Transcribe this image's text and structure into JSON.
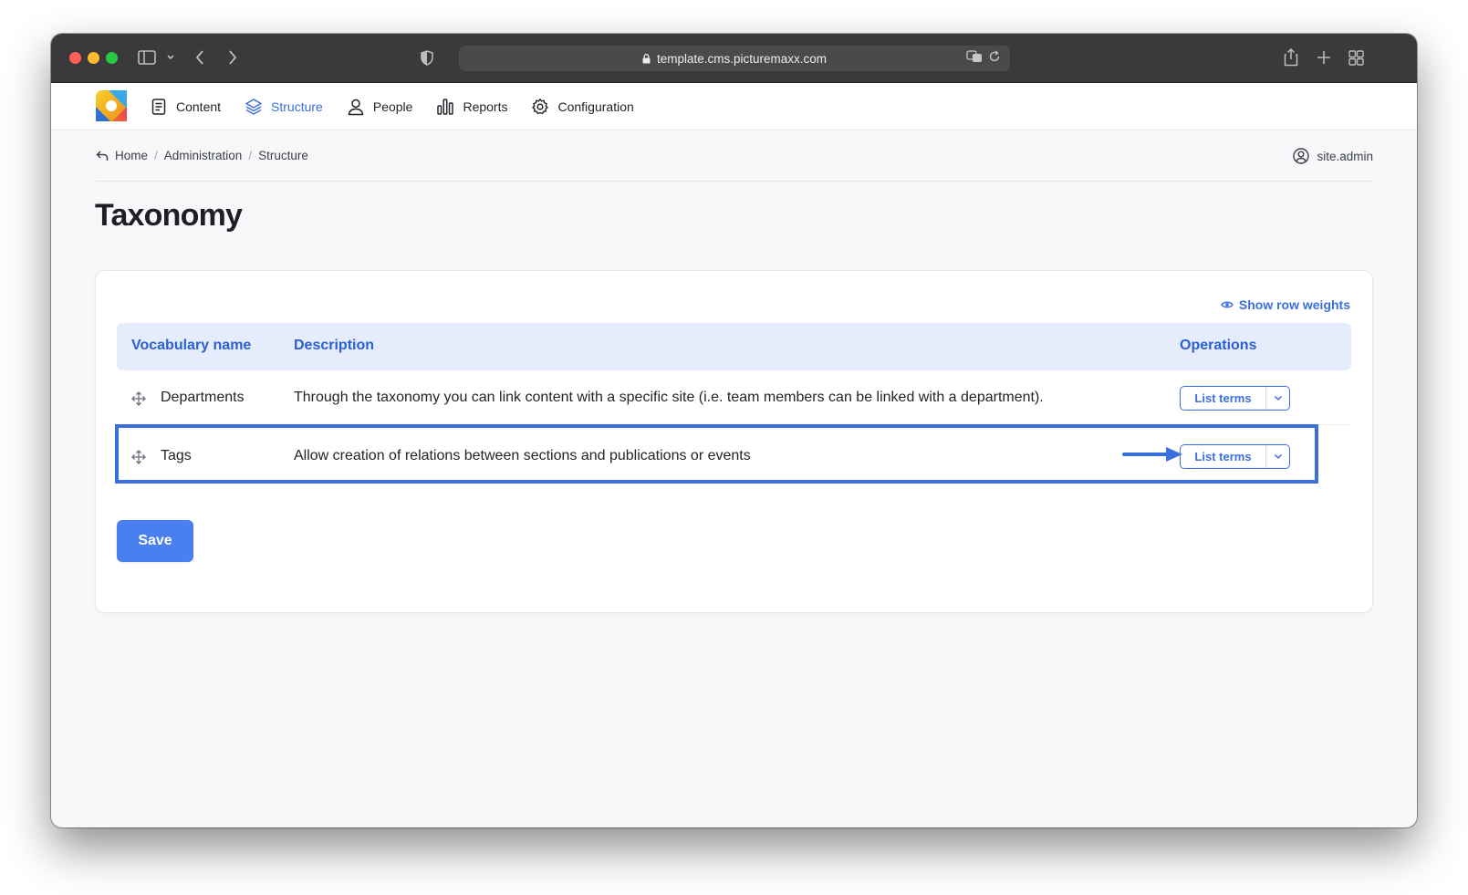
{
  "browser": {
    "url": "template.cms.picturemaxx.com"
  },
  "nav": {
    "items": [
      {
        "label": "Content",
        "icon": "document-icon"
      },
      {
        "label": "Structure",
        "icon": "layers-icon",
        "active": true
      },
      {
        "label": "People",
        "icon": "user-icon"
      },
      {
        "label": "Reports",
        "icon": "bar-chart-icon"
      },
      {
        "label": "Configuration",
        "icon": "gear-icon"
      }
    ]
  },
  "breadcrumb": {
    "items": [
      "Home",
      "Administration",
      "Structure"
    ],
    "user": "site.admin"
  },
  "page": {
    "title": "Taxonomy"
  },
  "table": {
    "show_weights_label": "Show row weights",
    "headers": {
      "name": "Vocabulary name",
      "description": "Description",
      "operations": "Operations"
    },
    "rows": [
      {
        "name": "Departments",
        "description": "Through the taxonomy you can link content with a specific site (i.e. team members can be linked with a department).",
        "operation": "List terms"
      },
      {
        "name": "Tags",
        "description": "Allow creation of relations between sections and publications or events",
        "operation": "List terms",
        "highlighted": true
      }
    ]
  },
  "form": {
    "save_label": "Save"
  },
  "colors": {
    "accent": "#3b6fe0",
    "header_bg": "#e5ecfc",
    "titlebar": "#3a3a3c"
  }
}
